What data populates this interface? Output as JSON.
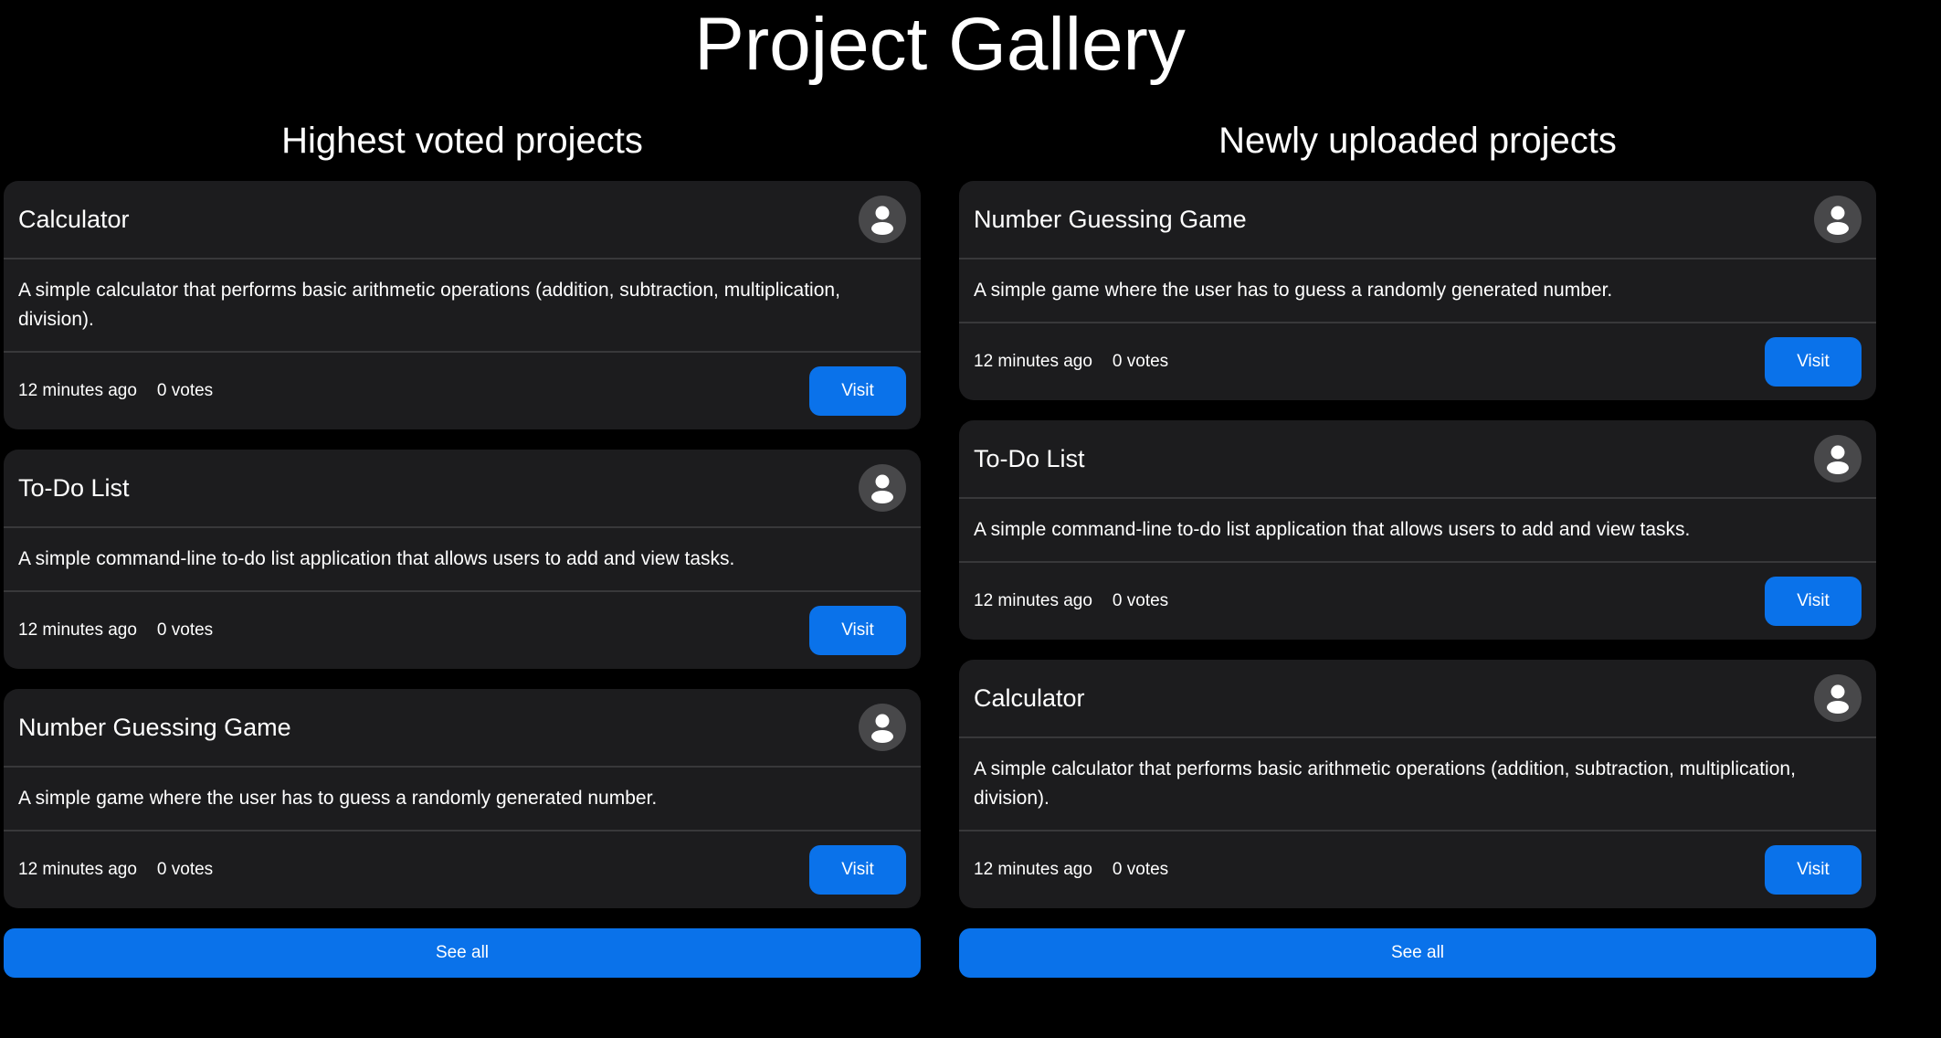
{
  "page": {
    "title": "Project Gallery"
  },
  "highest_voted": {
    "heading": "Highest voted projects",
    "see_all_label": "See all",
    "projects": [
      {
        "title": "Calculator",
        "description": "A simple calculator that performs basic arithmetic operations (addition, subtraction, multiplication, division).",
        "time": "12 minutes ago",
        "votes": "0 votes",
        "visit_label": "Visit",
        "avatar_icon": "user-avatar-icon"
      },
      {
        "title": "To-Do List",
        "description": "A simple command-line to-do list application that allows users to add and view tasks.",
        "time": "12 minutes ago",
        "votes": "0 votes",
        "visit_label": "Visit",
        "avatar_icon": "user-avatar-icon"
      },
      {
        "title": "Number Guessing Game",
        "description": "A simple game where the user has to guess a randomly generated number.",
        "time": "12 minutes ago",
        "votes": "0 votes",
        "visit_label": "Visit",
        "avatar_icon": "user-avatar-icon"
      }
    ]
  },
  "newly_uploaded": {
    "heading": "Newly uploaded projects",
    "see_all_label": "See all",
    "projects": [
      {
        "title": "Number Guessing Game",
        "description": "A simple game where the user has to guess a randomly generated number.",
        "time": "12 minutes ago",
        "votes": "0 votes",
        "visit_label": "Visit",
        "avatar_icon": "user-avatar-icon"
      },
      {
        "title": "To-Do List",
        "description": "A simple command-line to-do list application that allows users to add and view tasks.",
        "time": "12 minutes ago",
        "votes": "0 votes",
        "visit_label": "Visit",
        "avatar_icon": "user-avatar-icon"
      },
      {
        "title": "Calculator",
        "description": "A simple calculator that performs basic arithmetic operations (addition, subtraction, multiplication, division).",
        "time": "12 minutes ago",
        "votes": "0 votes",
        "visit_label": "Visit",
        "avatar_icon": "user-avatar-icon"
      }
    ]
  },
  "colors": {
    "background": "#000000",
    "card": "#1c1c1e",
    "divider": "#38383a",
    "accent": "#0a72ea",
    "avatar_bg": "#48484a"
  }
}
